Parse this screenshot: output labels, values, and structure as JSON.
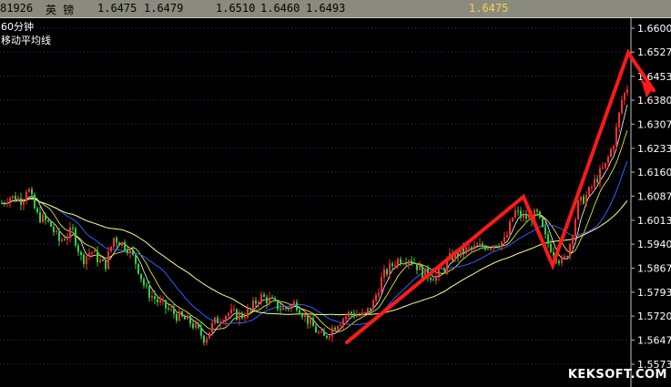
{
  "quote_bar": {
    "code": "81926",
    "name": "英    镑",
    "open": "1.6475",
    "prev": "1.6479",
    "high": "1.6510",
    "low": "1.6460",
    "last": "1.6493",
    "current": "1.6475"
  },
  "chart_title": {
    "period": "60分钟",
    "indicator": "移动平均线"
  },
  "watermark": "KEKSOFT.COM",
  "colors": {
    "background": "#000000",
    "up_candle": "#ff3030",
    "down_candle": "#30d040",
    "ma_short": "#ffffff",
    "ma_mid": "#ffff40",
    "ma_long": "#3060ff",
    "ma_longest": "#ffff80",
    "annotation": "#ff1a1a",
    "grid": "#1e3a66",
    "axis_text": "#ffffff"
  },
  "chart_data": {
    "type": "candlestick",
    "ylim": [
      1.5573,
      1.66
    ],
    "yticks": [
      "1.6600",
      "1.6527",
      "1.6453",
      "1.6380",
      "1.6307",
      "1.6233",
      "1.6160",
      "1.6087",
      "1.6013",
      "1.5940",
      "1.5867",
      "1.5793",
      "1.5720",
      "1.5647",
      "1.5573"
    ],
    "grid": "horizontal dotted",
    "candle_count": 230,
    "price_path": [
      [
        0,
        1.606
      ],
      [
        10,
        1.6085
      ],
      [
        25,
        1.6075
      ],
      [
        30,
        1.612
      ],
      [
        40,
        1.603
      ],
      [
        55,
        1.6
      ],
      [
        65,
        1.595
      ],
      [
        80,
        1.598
      ],
      [
        90,
        1.589
      ],
      [
        100,
        1.592
      ],
      [
        115,
        1.587
      ],
      [
        125,
        1.596
      ],
      [
        140,
        1.593
      ],
      [
        150,
        1.588
      ],
      [
        160,
        1.58
      ],
      [
        175,
        1.576
      ],
      [
        195,
        1.572
      ],
      [
        210,
        1.57
      ],
      [
        225,
        1.565
      ],
      [
        235,
        1.57
      ],
      [
        250,
        1.573
      ],
      [
        265,
        1.572
      ],
      [
        275,
        1.574
      ],
      [
        285,
        1.578
      ],
      [
        295,
        1.577
      ],
      [
        310,
        1.574
      ],
      [
        325,
        1.576
      ],
      [
        340,
        1.57
      ],
      [
        355,
        1.565
      ],
      [
        370,
        1.57
      ],
      [
        385,
        1.573
      ],
      [
        400,
        1.572
      ],
      [
        410,
        1.576
      ],
      [
        420,
        1.584
      ],
      [
        435,
        1.589
      ],
      [
        450,
        1.59
      ],
      [
        465,
        1.585
      ],
      [
        480,
        1.584
      ],
      [
        495,
        1.59
      ],
      [
        510,
        1.592
      ],
      [
        525,
        1.593
      ],
      [
        540,
        1.594
      ],
      [
        555,
        1.595
      ],
      [
        565,
        1.604
      ],
      [
        575,
        1.602
      ],
      [
        590,
        1.603
      ],
      [
        600,
        1.595
      ],
      [
        610,
        1.591
      ],
      [
        618,
        1.588
      ],
      [
        625,
        1.593
      ],
      [
        635,
        1.606
      ],
      [
        645,
        1.609
      ],
      [
        655,
        1.614
      ],
      [
        665,
        1.618
      ],
      [
        675,
        1.626
      ],
      [
        683,
        1.638
      ],
      [
        689,
        1.642
      ]
    ],
    "annotation_arrows": [
      [
        381,
        1.564
      ],
      [
        575,
        1.6085
      ],
      [
        607,
        1.5875
      ],
      [
        690,
        1.6525
      ],
      [
        718,
        1.641
      ]
    ]
  }
}
